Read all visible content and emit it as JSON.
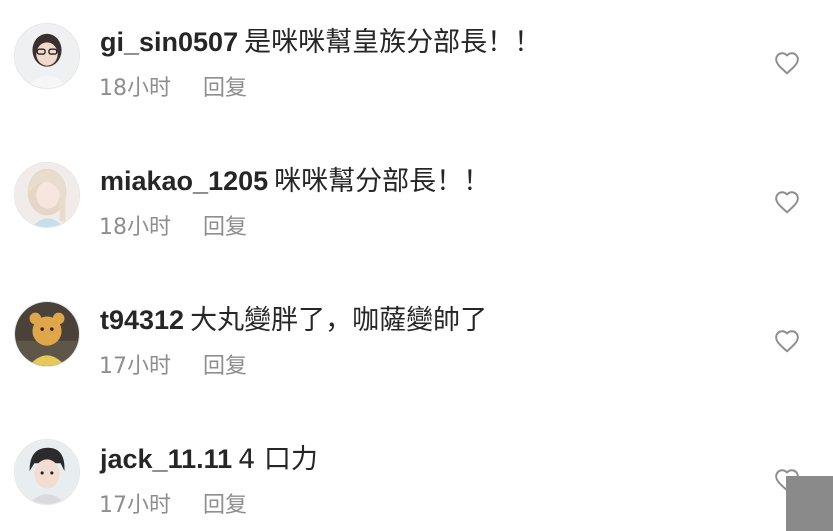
{
  "comments": [
    {
      "username": "gi_sin0507",
      "text": "是咪咪幫皇族分部長！！",
      "timestamp": "18小时",
      "reply_label": "回复"
    },
    {
      "username": "miakao_1205",
      "text": "咪咪幫分部長！！",
      "timestamp": "18小时",
      "reply_label": "回复"
    },
    {
      "username": "t94312",
      "text": "大丸變胖了，咖薩變帥了",
      "timestamp": "17小时",
      "reply_label": "回复"
    },
    {
      "username": "jack_11.11",
      "text": "4 口力",
      "timestamp": "17小时",
      "reply_label": "回复"
    }
  ],
  "colors": {
    "username": "#262626",
    "text": "#262626",
    "meta": "#8e8e8e",
    "heart_stroke": "#8e8e8e",
    "background": "#ffffff"
  },
  "icons": {
    "like": "heart-outline-icon"
  }
}
